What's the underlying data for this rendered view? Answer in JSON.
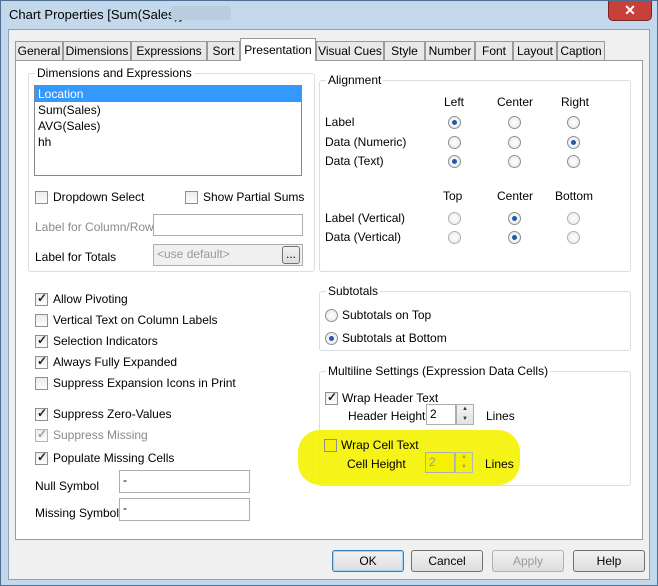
{
  "window": {
    "title": "Chart Properties [Sum(Sales)]",
    "close_glyph": "✕"
  },
  "tabs": [
    "General",
    "Dimensions",
    "Expressions",
    "Sort",
    "Presentation",
    "Visual Cues",
    "Style",
    "Number",
    "Font",
    "Layout",
    "Caption"
  ],
  "active_tab": "Presentation",
  "dims": {
    "group_label": "Dimensions and Expressions",
    "items": [
      "Location",
      "Sum(Sales)",
      "AVG(Sales)",
      "hh"
    ],
    "selected": "Location",
    "dropdown_select": "Dropdown Select",
    "show_partial_sums": "Show Partial Sums",
    "label_for_column_row": "Label for Column/Row",
    "label_for_totals": "Label for Totals",
    "totals_placeholder": "<use default>",
    "browse": "..."
  },
  "alignment": {
    "group_label": "Alignment",
    "cols_h": [
      "Left",
      "Center",
      "Right"
    ],
    "rows_h": [
      "Label",
      "Data (Numeric)",
      "Data (Text)"
    ],
    "cols_v": [
      "Top",
      "Center",
      "Bottom"
    ],
    "rows_v": [
      "Label (Vertical)",
      "Data (Vertical)"
    ]
  },
  "options": {
    "allow_pivoting": "Allow Pivoting",
    "vertical_text": "Vertical Text on Column Labels",
    "selection_indicators": "Selection Indicators",
    "always_fully_expanded": "Always Fully Expanded",
    "suppress_expansion_icons": "Suppress Expansion Icons in Print",
    "suppress_zero_values": "Suppress Zero-Values",
    "suppress_missing": "Suppress Missing",
    "populate_missing_cells": "Populate Missing Cells",
    "null_symbol_label": "Null Symbol",
    "null_symbol_value": "-",
    "missing_symbol_label": "Missing Symbol",
    "missing_symbol_value": "-"
  },
  "subtotals": {
    "group_label": "Subtotals",
    "on_top": "Subtotals on Top",
    "at_bottom": "Subtotals at Bottom"
  },
  "multiline": {
    "group_label": "Multiline Settings (Expression Data Cells)",
    "wrap_header": "Wrap Header Text",
    "header_height_label": "Header Height",
    "header_height_value": "2",
    "lines": "Lines",
    "wrap_cell": "Wrap Cell Text",
    "cell_height_label": "Cell Height",
    "cell_height_value": "2"
  },
  "buttons": {
    "ok": "OK",
    "cancel": "Cancel",
    "apply": "Apply",
    "help": "Help"
  },
  "colors": {
    "highlight": "#f5f200",
    "selection": "#3399ff"
  }
}
